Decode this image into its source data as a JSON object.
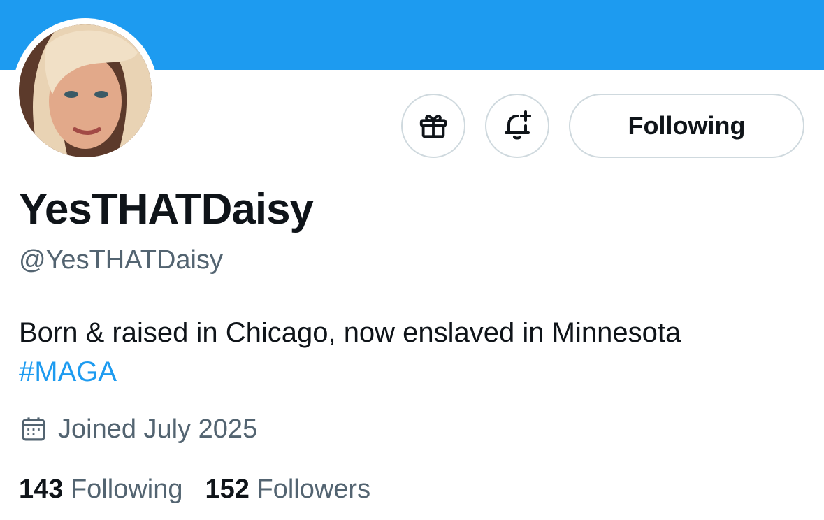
{
  "profile": {
    "display_name": "YesTHATDaisy",
    "handle": "@YesTHATDaisy",
    "bio_text": "Born & raised in Chicago, now enslaved in Minnesota",
    "bio_hashtag": "#MAGA",
    "joined": "Joined July 2025"
  },
  "actions": {
    "gift_icon": "gift-icon",
    "bell_icon": "bell-plus-icon",
    "following_label": "Following"
  },
  "stats": {
    "following_count": "143",
    "following_label": "Following",
    "followers_count": "152",
    "followers_label": "Followers"
  },
  "colors": {
    "banner": "#1d9bf0",
    "accent": "#1d9bf0",
    "text": "#0f1419",
    "muted": "#536471",
    "border": "#cfd9de"
  }
}
